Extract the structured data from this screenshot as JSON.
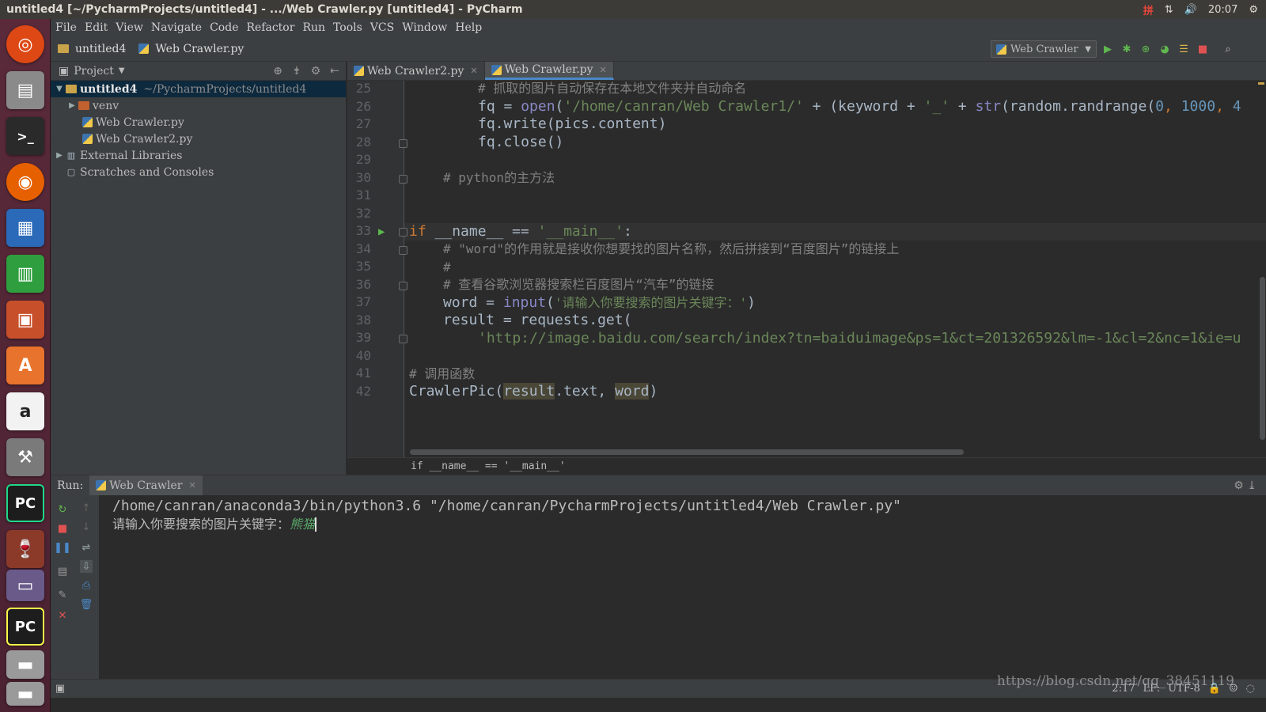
{
  "window": {
    "title": "untitled4 [~/PycharmProjects/untitled4] - .../Web Crawler.py [untitled4] - PyCharm",
    "tray": {
      "ime": "拼",
      "time": "20:07"
    }
  },
  "menu": [
    "File",
    "Edit",
    "View",
    "Navigate",
    "Code",
    "Refactor",
    "Run",
    "Tools",
    "VCS",
    "Window",
    "Help"
  ],
  "navbar": {
    "project": "untitled4",
    "file": "Web Crawler.py",
    "run_config": "Web Crawler"
  },
  "project_panel": {
    "header": "Project",
    "tree": [
      {
        "label": "untitled4",
        "path": "~/PycharmProjects/untitled4",
        "type": "folder"
      },
      {
        "label": "venv",
        "type": "folder-red"
      },
      {
        "label": "Web Crawler.py",
        "type": "py"
      },
      {
        "label": "Web Crawler2.py",
        "type": "py"
      },
      {
        "label": "External Libraries",
        "type": "lib"
      },
      {
        "label": "Scratches and Consoles",
        "type": "scratch"
      }
    ]
  },
  "editor_tabs": [
    {
      "label": "Web Crawler2.py",
      "active": false
    },
    {
      "label": "Web Crawler.py",
      "active": true
    }
  ],
  "code": {
    "line_numbers": [
      "25",
      "26",
      "27",
      "28",
      "29",
      "30",
      "31",
      "32",
      "33",
      "34",
      "35",
      "36",
      "37",
      "38",
      "39",
      "40",
      "41",
      "42"
    ],
    "l25_comment": "# 抓取的图片自动保存在本地文件夹并自动命名",
    "l26": {
      "a": "fq = ",
      "b": "open",
      "c": "(",
      "d": "'/home/canran/Web Crawler1/'",
      "e": " + (keyword + ",
      "f": "'_'",
      "g": " + ",
      "h": "str",
      "i": "(random.randrange(",
      "j": "0",
      "k": ", ",
      "l": "1000",
      "m": ", ",
      "n": "4"
    },
    "l27": "fq.write(pics.content)",
    "l28": "fq.close()",
    "l30_comment": "# python的主方法",
    "l33": {
      "kw": "if",
      "rest": " __name__ == ",
      "str": "'__main__'",
      "end": ":"
    },
    "l34_comment": "# \"word\"的作用就是接收你想要找的图片名称，然后拼接到“百度图片”的链接上",
    "l35_comment": "#",
    "l36_comment": "# 查看谷歌浏览器搜索栏百度图片“汽车”的链接",
    "l37": {
      "a": "word = ",
      "b": "input",
      "c": "(",
      "d": "'请输入你要搜索的图片关键字：'",
      "e": ")"
    },
    "l38": "result = requests.get(",
    "l39": "'http://image.baidu.com/search/index?tn=baiduimage&ps=1&ct=201326592&lm=-1&cl=2&nc=1&ie=u",
    "l41_comment": "# 调用函数",
    "l42": {
      "a": "CrawlerPic(",
      "b": "result",
      "c": ".text, ",
      "d": "word",
      "e": ")"
    }
  },
  "breadcrumb_strip": "if __name__ == '__main__'",
  "run_panel": {
    "label": "Run:",
    "tab": "Web Crawler",
    "console_line1": "/home/canran/anaconda3/bin/python3.6 \"/home/canran/PycharmProjects/untitled4/Web Crawler.py\"",
    "console_prompt": "请输入你要搜索的图片关键字：",
    "console_input": "熊猫"
  },
  "status": {
    "position": "2:17",
    "line_sep": "LF:",
    "encoding": "UTF-8",
    "watermark": "https://blog.csdn.net/qq_38451119"
  }
}
